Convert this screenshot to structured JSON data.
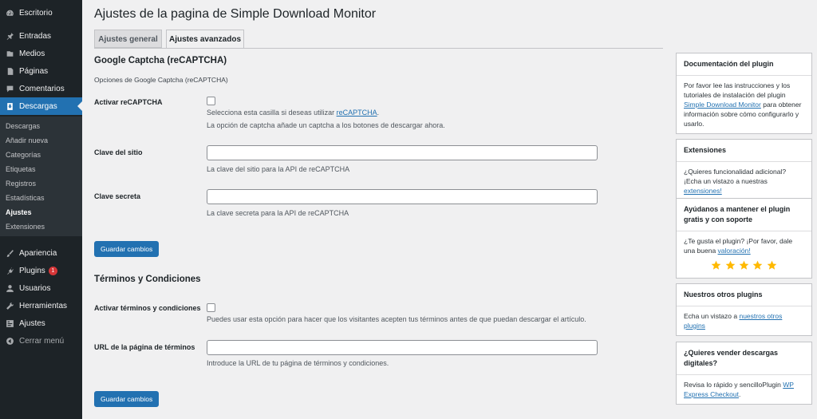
{
  "admin_menu": {
    "items": [
      {
        "label": "Escritorio",
        "icon": "dashboard-icon"
      },
      {
        "label": "Entradas",
        "icon": "pin-icon"
      },
      {
        "label": "Medios",
        "icon": "media-icon"
      },
      {
        "label": "Páginas",
        "icon": "pages-icon"
      },
      {
        "label": "Comentarios",
        "icon": "comments-icon"
      },
      {
        "label": "Descargas",
        "icon": "download-icon"
      },
      {
        "label": "Apariencia",
        "icon": "brush-icon"
      },
      {
        "label": "Plugins",
        "icon": "plugin-icon",
        "badge": "1"
      },
      {
        "label": "Usuarios",
        "icon": "users-icon"
      },
      {
        "label": "Herramientas",
        "icon": "wrench-icon"
      },
      {
        "label": "Ajustes",
        "icon": "settings-icon"
      },
      {
        "label": "Cerrar menú",
        "icon": "collapse-icon"
      }
    ],
    "submenu": [
      "Descargas",
      "Añadir nueva",
      "Categorías",
      "Etiquetas",
      "Registros",
      "Estadísticas",
      "Ajustes",
      "Extensiones"
    ],
    "accent_color": "#2271b1",
    "badge_color": "#d63638"
  },
  "page": {
    "title": "Ajustes de la pagina de Simple Download Monitor",
    "tabs": [
      "Ajustes general",
      "Ajustes avanzados"
    ],
    "active_tab": "Ajustes avanzados"
  },
  "captcha": {
    "title": "Google Captcha (reCAPTCHA)",
    "description": "Opciones de Google Captcha (reCAPTCHA)",
    "enable_label": "Activar reCAPTCHA",
    "enable_desc_prefix": "Selecciona esta casilla si deseas utilizar ",
    "enable_desc_link": "reCAPTCHA",
    "enable_desc_suffix": ".",
    "enable_desc2": "La opción de captcha añade un captcha a los botones de descargar ahora.",
    "site_key_label": "Clave del sitio",
    "site_key_value": "",
    "site_key_desc": "La clave del sitio para la API de reCAPTCHA",
    "secret_key_label": "Clave secreta",
    "secret_key_value": "",
    "secret_key_desc": "La clave secreta para la API de reCAPTCHA",
    "save_label": "Guardar cambios"
  },
  "terms": {
    "title": "Términos y Condiciones",
    "enable_label": "Activar términos y condiciones",
    "enable_desc": "Puedes usar esta opción para hacer que los visitantes acepten tus términos antes de que puedan descargar el artículo.",
    "url_label": "URL de la página de términos",
    "url_value": "",
    "url_desc": "Introduce la URL de tu página de términos y condiciones.",
    "save_label": "Guardar cambios"
  },
  "sidebar": {
    "docs": {
      "title": "Documentación del plugin",
      "text_prefix": "Por favor lee las instrucciones y los tutoriales de instalación del plugin ",
      "link": "Simple Download Monitor",
      "text_suffix": " para obtener información sobre cómo configurarlo y usarlo."
    },
    "extensions": {
      "title": "Extensiones",
      "text_prefix": "¿Quieres funcionalidad adicional? ¡Echa un vistazo a nuestras ",
      "link": "extensiones!",
      "text_suffix": ""
    },
    "support": {
      "title": "Ayúdanos a mantener el plugin gratis y con soporte",
      "text_prefix": "¿Te gusta el plugin? ¡Por favor, dale una buena ",
      "link": "valoración!",
      "text_suffix": "",
      "rating": 5,
      "star_color": "#ffb900"
    },
    "plugins": {
      "title": "Nuestros otros plugins",
      "text_prefix": "Echa un vistazo a ",
      "link": "nuestros otros plugins",
      "text_suffix": ""
    },
    "sell": {
      "title": "¿Quieres vender descargas digitales?",
      "text_prefix": "Revisa lo rápido y sencilloPlugin ",
      "link": "WP Express Checkout",
      "text_suffix": "."
    }
  }
}
